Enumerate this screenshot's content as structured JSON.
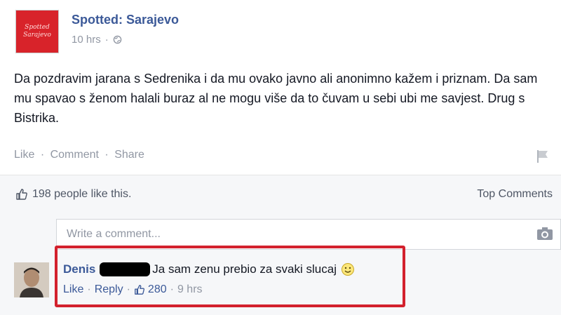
{
  "post": {
    "page_name": "Spotted: Sarajevo",
    "avatar_text_line1": "Spotted",
    "avatar_text_line2": "Sarajevo",
    "time": "10 hrs",
    "privacy_icon": "globe-icon",
    "text": "Da pozdravim jarana s Sedrenika i da mu ovako javno ali anonimno kažem i priznam. Da sam mu spavao s ženom halali buraz al ne mogu više da to čuvam u sebi ubi me savjest. Drug s Bistrika.",
    "actions": [
      "Like",
      "Comment",
      "Share"
    ]
  },
  "likes": {
    "text": "198 people like this.",
    "top_comments_label": "Top Comments"
  },
  "composer": {
    "placeholder": "Write a comment..."
  },
  "comment": {
    "author": "Denis",
    "body": "Ja sam zenu prebio za svaki slucaj",
    "like_label": "Like",
    "reply_label": "Reply",
    "like_count": "280",
    "time": "9 hrs"
  },
  "colors": {
    "link_blue": "#3b5998",
    "highlight_red": "#d3212d",
    "page_avatar_red": "#d8232a",
    "muted_gray": "#9197a3"
  }
}
